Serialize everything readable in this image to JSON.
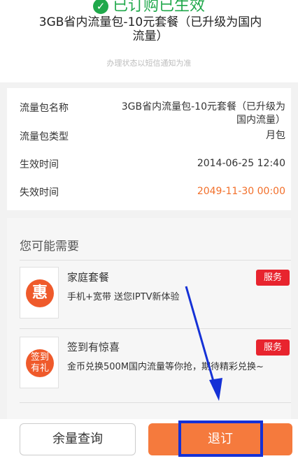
{
  "header": {
    "status": "已订购已生效",
    "package_title": "3GB省内流量包-10元套餐（已升级为国内流量）",
    "notice": "办理状态以短信通知为准"
  },
  "details": {
    "rows": [
      {
        "label": "流量包名称",
        "value": "3GB省内流量包-10元套餐（已升级为国内流量）"
      },
      {
        "label": "流量包类型",
        "value": "月包"
      },
      {
        "label": "生效时间",
        "value": "2014-06-25 12:40"
      },
      {
        "label": "失效时间",
        "value": "2049-11-30 00:00"
      }
    ]
  },
  "recommend": {
    "title": "您可能需要",
    "items": [
      {
        "icon_text": "惠",
        "name": "家庭套餐",
        "desc": "手机+宽带 送您IPTV新体验",
        "tag": "服务"
      },
      {
        "icon_text": "签到\n有礼",
        "name": "签到有惊喜",
        "desc": "金币兑换500M国内流量等你抢，期待精彩兑换~",
        "tag": "服务"
      }
    ]
  },
  "actions": {
    "balance_label": "余量查询",
    "unsubscribe_label": "退订"
  },
  "colors": {
    "accent": "#f57a3d",
    "success": "#20a84b",
    "tag": "#e8242e",
    "annotation": "#1531d6",
    "expire": "#f26f2a"
  }
}
